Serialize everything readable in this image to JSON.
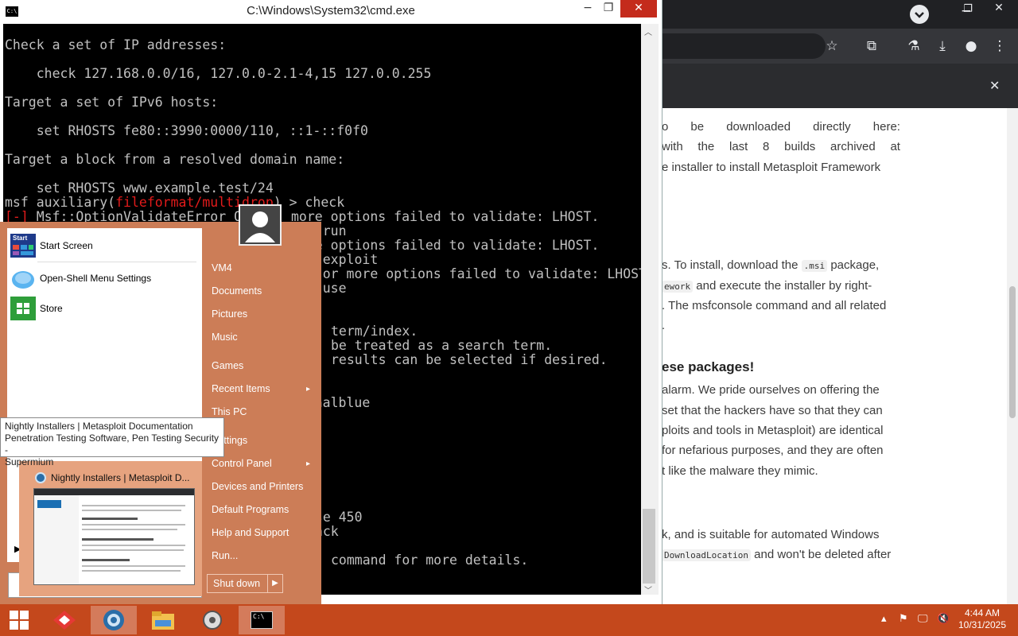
{
  "browser": {
    "notif_close": "✕",
    "paragraphs": [
      {
        "lines": [
          {
            "justify": true,
            "words": [
              "o",
              "be",
              "downloaded",
              "directly",
              "here:"
            ]
          },
          {
            "justify": true,
            "words": [
              "with",
              "the",
              "last",
              "8",
              "builds",
              "archived",
              "at"
            ]
          },
          {
            "justify": false,
            "text": "e installer to install Metasploit Framework"
          }
        ]
      }
    ],
    "install_text": {
      "l1_pre": "s. To install, download the ",
      "l1_code": ".msi",
      "l1_post": " package,",
      "l2_code": "ework",
      "l2_post": " and execute the installer by right-",
      "l3": ". The msfconsole command and all related",
      "l4": "."
    },
    "heading": "ese packages!",
    "para2": [
      "alarm. We pride ourselves on offering the",
      "set that the hackers have so that they can",
      "ploits and tools in Metasploit) are identical",
      "for nefarious purposes, and they are often",
      "t like the malware they mimic."
    ],
    "para3_l1": "k, and is suitable for automated Windows",
    "para3_l2_code": "DownloadLocation",
    "para3_l2_post": " and won't be deleted after"
  },
  "cmd": {
    "title": "C:\\Windows\\System32\\cmd.exe",
    "icon_label": "C:\\",
    "lines": [
      {
        "text": "Check a set of IP addresses:"
      },
      {
        "text": "    check 127.168.0.0/16, 127.0.0-2.1-4,15 127.0.0.255"
      },
      {
        "text": "Target a set of IPv6 hosts:"
      },
      {
        "text": "    set RHOSTS fe80::3990:0000/110, ::1-::f0f0"
      },
      {
        "text": "Target a block from a resolved domain name:"
      },
      {
        "text": "    set RHOSTS www.example.test/24"
      }
    ],
    "prompt_pre": "msf auxiliary(",
    "prompt_mod": "fileformat/multidrop",
    "prompt_post": ") > check",
    "err_mark": "[-]",
    "err_text": " Msf::OptionValidateError O",
    "right_lines": [
      {
        "text": "more options failed to validate: LHOST."
      },
      {
        "text": ") > run"
      },
      {
        "text": "more options failed to validate: LHOST."
      },
      {
        "text": ") > exploit"
      },
      {
        "text": "One or more options failed to validate: LHOST."
      },
      {
        "text": ") > use"
      }
    ],
    "mid_lines": [
      {
        "text": "term/index."
      },
      {
        "text": "be treated as a search term."
      },
      {
        "text": "results can be selected if desired."
      }
    ],
    "search_line": "eternalblue",
    "bottom_lines": [
      {
        "text": "use 450"
      },
      {
        "text": "back"
      },
      {
        "text": "command for more details."
      }
    ]
  },
  "startmenu": {
    "pinned": [
      {
        "label": "Start Screen"
      },
      {
        "label": "Open-Shell Menu Settings"
      },
      {
        "label": "Store"
      }
    ],
    "right_items": [
      {
        "label": "VM4"
      },
      {
        "label": "Documents"
      },
      {
        "label": "Pictures"
      },
      {
        "label": "Music"
      },
      {
        "label": "Games"
      },
      {
        "label": "Recent Items"
      },
      {
        "label": "This PC"
      },
      {
        "label": "Settings"
      },
      {
        "label": "Control Panel"
      },
      {
        "label": "Devices and Printers"
      },
      {
        "label": "Default Programs"
      },
      {
        "label": "Help and Support"
      },
      {
        "label": "Run..."
      }
    ],
    "shutdown_label": "Shut down",
    "tooltip_lines": [
      "Nightly Installers | Metasploit Documentation",
      "Penetration Testing Software, Pen Testing Security -",
      "Supermium"
    ],
    "jump_title": "Nightly Installers | Metasploit D...",
    "start_tile_label": "Start"
  },
  "taskbar": {
    "time": "4:44 AM",
    "date": "10/31/2025",
    "apps": [
      "start-button",
      "metasploit",
      "supermium-browser",
      "file-explorer",
      "settings",
      "cmd"
    ]
  },
  "colors": {
    "accent": "#c4481c",
    "terminal_bg": "#000000",
    "terminal_text": "#c0c0c0",
    "terminal_red": "#e31b1b"
  }
}
